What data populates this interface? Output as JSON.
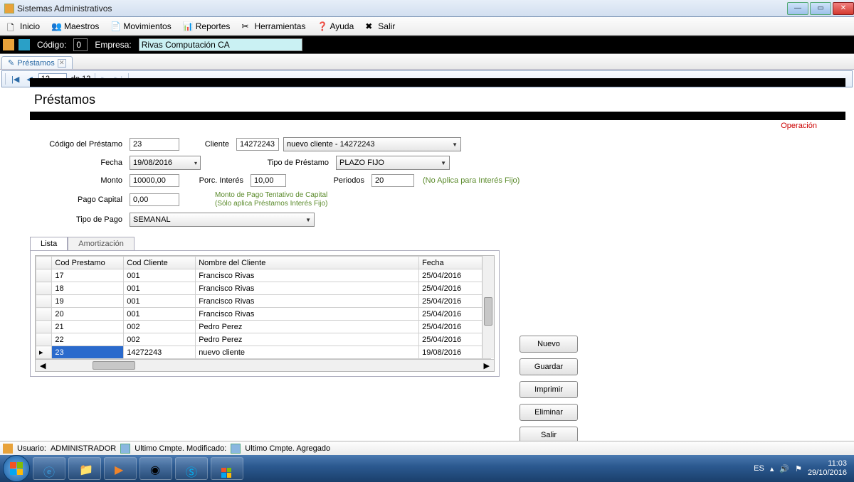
{
  "window": {
    "title": "Sistemas Administrativos"
  },
  "menu": {
    "items": [
      "Inicio",
      "Maestros",
      "Movimientos",
      "Reportes",
      "Herramientas",
      "Ayuda",
      "Salir"
    ]
  },
  "codebar": {
    "codigo_label": "Código:",
    "codigo_value": "0",
    "empresa_label": "Empresa:",
    "empresa_value": "Rivas Computación CA"
  },
  "tab": {
    "title": "Préstamos"
  },
  "navigator": {
    "current": "12",
    "of_label": "de 12"
  },
  "page": {
    "title": "Préstamos",
    "operacion": "Operación",
    "labels": {
      "codigo": "Código del Préstamo",
      "cliente": "Cliente",
      "fecha": "Fecha",
      "tipo_prestamo": "Tipo de Préstamo",
      "monto": "Monto",
      "porc_interes": "Porc. Interés",
      "periodos": "Periodos",
      "pago_capital": "Pago Capital",
      "tipo_pago": "Tipo de Pago"
    },
    "values": {
      "codigo": "23",
      "cliente_id": "14272243",
      "cliente_sel": "nuevo cliente - 14272243",
      "fecha": "19/08/2016",
      "tipo_prestamo": "PLAZO FIJO",
      "monto": "10000,00",
      "porc_interes": "10,00",
      "periodos": "20",
      "pago_capital": "0,00",
      "tipo_pago": "SEMANAL"
    },
    "hints": {
      "periodos": "(No Aplica para Interés Fijo)",
      "pago_capital_1": "Monto de Pago Tentativo de Capital",
      "pago_capital_2": "(Sólo aplica Préstamos Interés Fijo)"
    }
  },
  "innerTabs": {
    "lista": "Lista",
    "amortizacion": "Amortización"
  },
  "grid": {
    "headers": {
      "cod_prestamo": "Cod Prestamo",
      "cod_cliente": "Cod Cliente",
      "nombre": "Nombre del Cliente",
      "fecha": "Fecha"
    },
    "rows": [
      {
        "cp": "17",
        "cc": "001",
        "nm": "Francisco Rivas",
        "fe": "25/04/2016"
      },
      {
        "cp": "18",
        "cc": "001",
        "nm": "Francisco Rivas",
        "fe": "25/04/2016"
      },
      {
        "cp": "19",
        "cc": "001",
        "nm": "Francisco Rivas",
        "fe": "25/04/2016"
      },
      {
        "cp": "20",
        "cc": "001",
        "nm": "Francisco Rivas",
        "fe": "25/04/2016"
      },
      {
        "cp": "21",
        "cc": "002",
        "nm": "Pedro Perez",
        "fe": "25/04/2016"
      },
      {
        "cp": "22",
        "cc": "002",
        "nm": "Pedro Perez",
        "fe": "25/04/2016"
      },
      {
        "cp": "23",
        "cc": "14272243",
        "nm": "nuevo cliente",
        "fe": "19/08/2016"
      }
    ]
  },
  "buttons": {
    "nuevo": "Nuevo",
    "guardar": "Guardar",
    "imprimir": "Imprimir",
    "eliminar": "Eliminar",
    "salir": "Salir"
  },
  "statusbar": {
    "usuario_label": "Usuario:",
    "usuario": "ADMINISTRADOR",
    "ultimo_mod": "Ultimo Cmpte. Modificado:",
    "ultimo_agr": "Ultimo Cmpte. Agregado"
  },
  "tray": {
    "lang": "ES",
    "time": "11:03",
    "date": "29/10/2016"
  }
}
